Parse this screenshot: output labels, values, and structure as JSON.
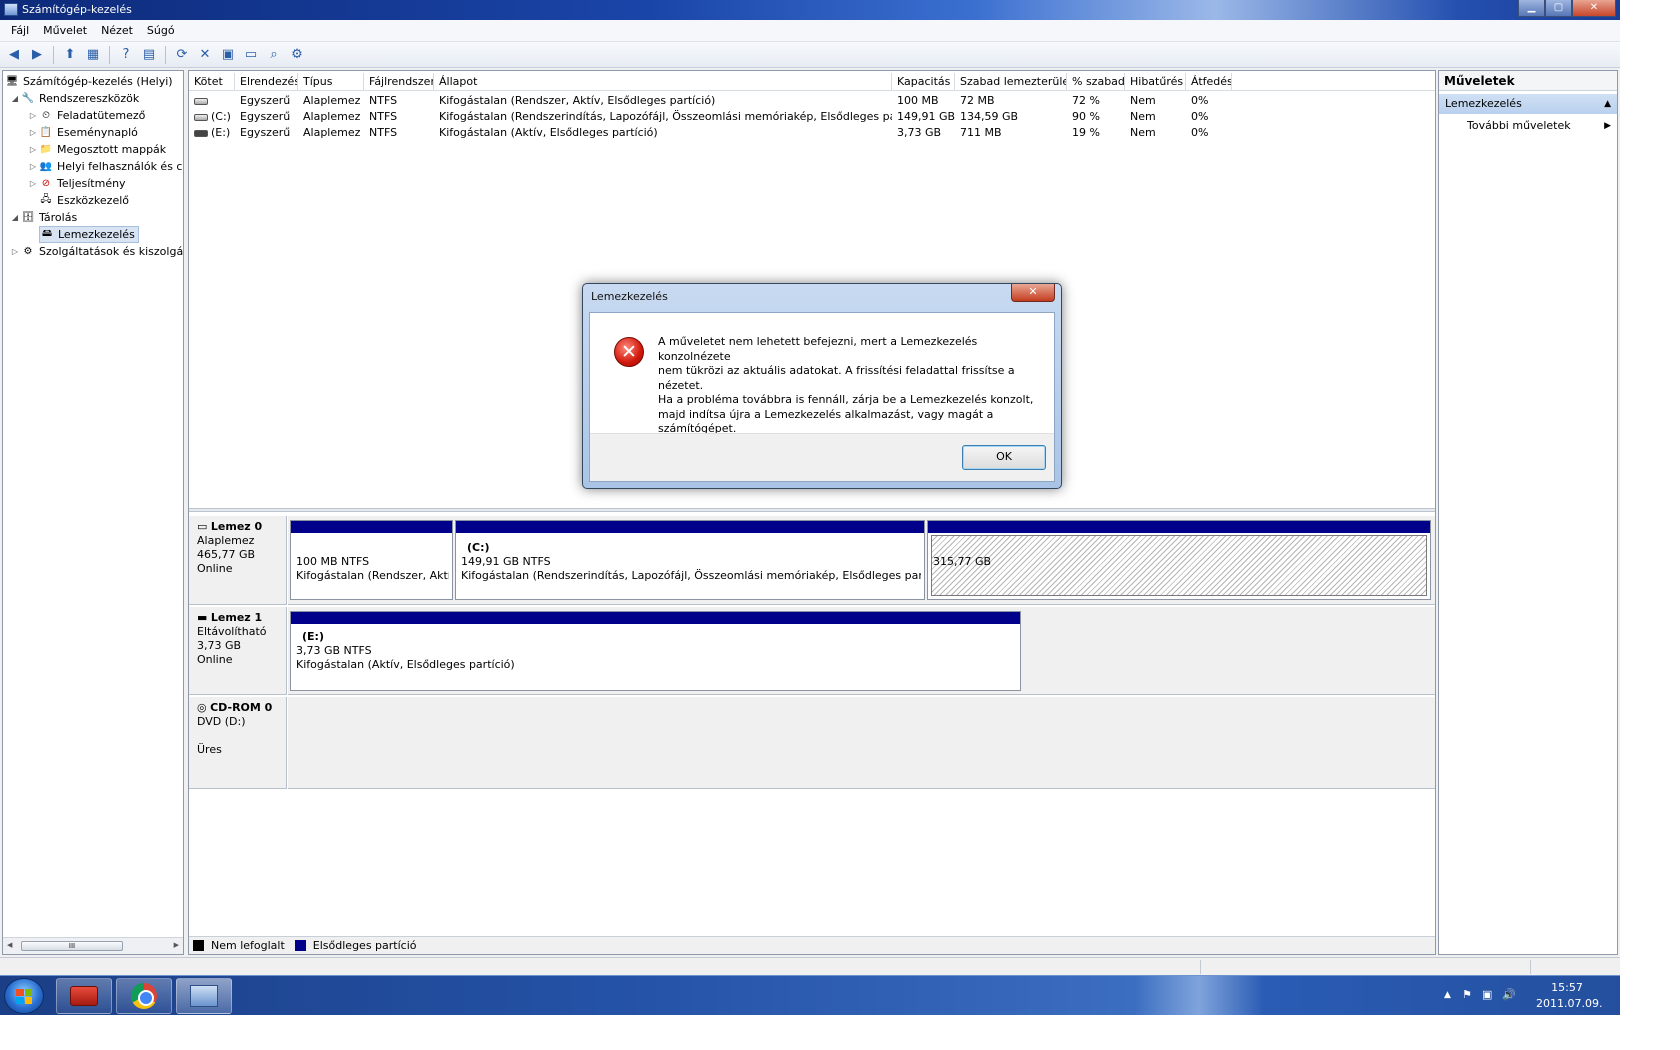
{
  "window": {
    "title": "Számítógép-kezelés",
    "controls": {
      "minimize": "▁",
      "maximize": "▢",
      "close": "✕"
    }
  },
  "menu": [
    "Fájl",
    "Művelet",
    "Nézet",
    "Súgó"
  ],
  "tree": {
    "nodes": [
      {
        "label": "Számítógép-kezelés (Helyi)",
        "icon": "computer-mgmt-icon",
        "arrow": ""
      },
      {
        "label": "Rendszereszközök",
        "icon": "system-tools-icon",
        "arrow": "◢"
      },
      {
        "label": "Feladatütemező",
        "icon": "task-scheduler-icon",
        "arrow": "▷"
      },
      {
        "label": "Eseménynapló",
        "icon": "event-viewer-icon",
        "arrow": "▷"
      },
      {
        "label": "Megosztott mappák",
        "icon": "shared-folders-icon",
        "arrow": "▷"
      },
      {
        "label": "Helyi felhasználók és cs",
        "icon": "local-users-icon",
        "arrow": "▷"
      },
      {
        "label": "Teljesítmény",
        "icon": "performance-icon",
        "arrow": "▷"
      },
      {
        "label": "Eszközkezelő",
        "icon": "device-manager-icon",
        "arrow": ""
      },
      {
        "label": "Tárolás",
        "icon": "storage-icon",
        "arrow": "◢"
      },
      {
        "label": "Lemezkezelés",
        "icon": "disk-management-icon",
        "arrow": ""
      },
      {
        "label": "Szolgáltatások és kiszolgáló",
        "icon": "services-icon",
        "arrow": "▷"
      }
    ],
    "scroll_thumb": "III"
  },
  "volumes": {
    "headers": [
      "Kötet",
      "Elrendezés",
      "Típus",
      "Fájlrendszer",
      "Állapot",
      "Kapacitás",
      "Szabad lemezterület",
      "% szabad",
      "Hibatűrés",
      "Átfedés"
    ],
    "rows": [
      [
        "",
        "Egyszerű",
        "Alaplemez",
        "NTFS",
        "Kifogástalan (Rendszer, Aktív, Elsődleges partíció)",
        "100 MB",
        "72 MB",
        "72 %",
        "Nem",
        "0%"
      ],
      [
        "(C:)",
        "Egyszerű",
        "Alaplemez",
        "NTFS",
        "Kifogástalan (Rendszerindítás, Lapozófájl, Összeomlási memóriakép, Elsődleges partíció)",
        "149,91 GB",
        "134,59 GB",
        "90 %",
        "Nem",
        "0%"
      ],
      [
        "(E:)",
        "Egyszerű",
        "Alaplemez",
        "NTFS",
        "Kifogástalan (Aktív, Elsődleges partíció)",
        "3,73 GB",
        "711 MB",
        "19 %",
        "Nem",
        "0%"
      ]
    ]
  },
  "disks": [
    {
      "name": "Lemez 0",
      "type": "Alaplemez",
      "size": "465,77 GB",
      "status": "Online",
      "partitions": [
        {
          "label": "",
          "size": "100 MB NTFS",
          "status": "Kifogástalan (Rendszer, Aktív, Elsődleges partíció)"
        },
        {
          "label": "(C:)",
          "size": "149,91 GB NTFS",
          "status": "Kifogástalan (Rendszerindítás, Lapozófájl, Összeomlási memóriakép, Elsődleges partíció)"
        },
        {
          "label": "",
          "size": "315,77 GB",
          "status": ""
        }
      ]
    },
    {
      "name": "Lemez 1",
      "type": "Eltávolítható",
      "size": "3,73 GB",
      "status": "Online",
      "partitions": [
        {
          "label": "(E:)",
          "size": "3,73 GB NTFS",
          "status": "Kifogástalan (Aktív, Elsődleges partíció)"
        }
      ]
    },
    {
      "name": "CD-ROM 0",
      "type": "DVD (D:)",
      "size": "",
      "status": "Üres",
      "partitions": []
    }
  ],
  "legend": [
    {
      "label": "Nem lefoglalt",
      "color": "#000000"
    },
    {
      "label": "Elsődleges partíció",
      "color": "#00008b"
    }
  ],
  "actions": {
    "title": "Műveletek",
    "section": "Lemezkezelés",
    "items": [
      "További műveletek"
    ]
  },
  "dialog": {
    "title": "Lemezkezelés",
    "close": "✕",
    "message_lines": [
      "A műveletet nem lehetett befejezni, mert a Lemezkezelés konzolnézete",
      "nem tükrözi az aktuális adatokat. A frissítési feladattal frissítse a nézetet.",
      "Ha a probléma továbbra is fennáll, zárja be a Lemezkezelés konzolt,",
      "majd indítsa újra a Lemezkezelés alkalmazást, vagy magát a",
      "számítógépet."
    ],
    "ok_label": "OK"
  },
  "taskbar": {
    "apps": [
      "toolbox-app-icon",
      "chrome-icon",
      "computer-management-taskbar-icon"
    ]
  },
  "clock": {
    "time": "15:57",
    "date": "2011.07.09."
  }
}
